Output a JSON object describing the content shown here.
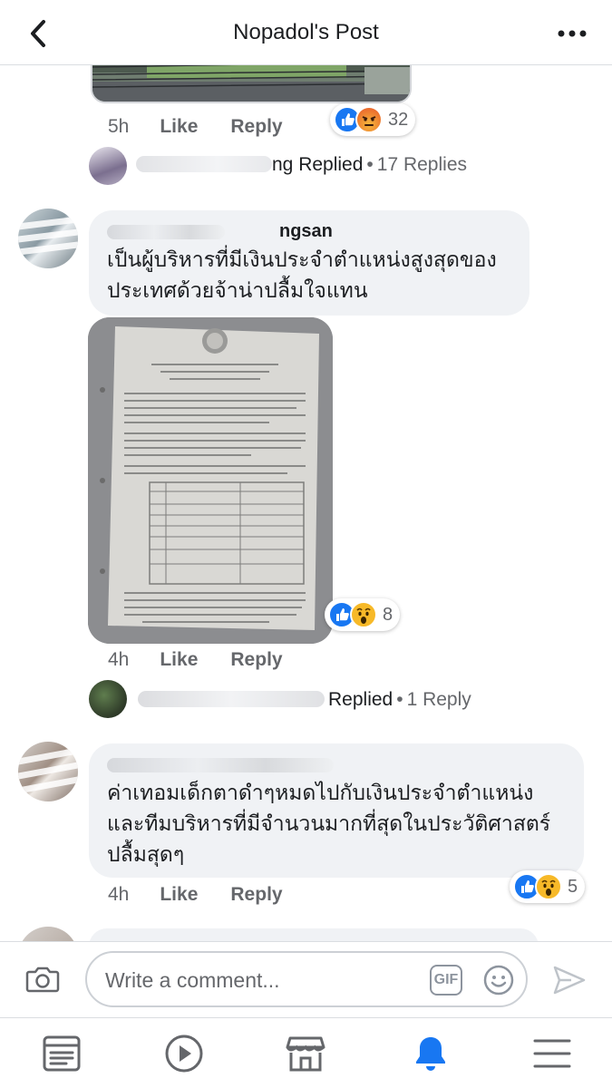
{
  "header": {
    "title": "Nopadol's Post",
    "back_icon": "chevron-left-icon",
    "more_icon": "more-horizontal-icon"
  },
  "colors": {
    "like_blue": "#1877f2",
    "angry_orange": "#f0772a",
    "wow_yellow": "#f7b928",
    "meta_gray": "#65676b",
    "bubble_bg": "#f0f2f5",
    "active_tab": "#1877f2"
  },
  "comments": [
    {
      "time": "5h",
      "like_label": "Like",
      "reply_label": "Reply",
      "reaction_count": "32",
      "reaction_icons": [
        "like-icon",
        "angry-icon"
      ],
      "reply_summary": {
        "name_visible": "ng Replied",
        "separator": "•",
        "count_label": "17 Replies"
      }
    },
    {
      "author_visible": "ngsan",
      "text": "เป็นผู้บริหารที่มีเงินประจำตำแหน่งสูงสุดของประเทศด้วยจ้าน่าปลื้มใจแทน",
      "time": "4h",
      "like_label": "Like",
      "reply_label": "Reply",
      "reaction_count": "8",
      "reaction_icons": [
        "like-icon",
        "wow-icon"
      ],
      "reply_summary": {
        "name_visible": "Replied",
        "separator": "•",
        "count_label": "1 Reply"
      }
    },
    {
      "text": "ค่าเทอมเด็กตาดำๆหมดไปกับเงินประจำตำแหน่ง และทีมบริหารที่มีจำนวนมากที่สุดในประวัติศาสตร์ ปลื้มสุดๆ",
      "time": "4h",
      "like_label": "Like",
      "reply_label": "Reply",
      "reaction_count": "5",
      "reaction_icons": [
        "like-icon",
        "wow-icon"
      ]
    }
  ],
  "composer": {
    "placeholder": "Write a comment...",
    "gif_label": "GIF",
    "camera_icon": "camera-icon",
    "emoji_icon": "emoji-icon",
    "send_icon": "send-icon"
  },
  "tabbar": {
    "items": [
      "news-feed-icon",
      "watch-icon",
      "marketplace-icon",
      "notifications-icon",
      "menu-icon"
    ],
    "active": "notifications-icon"
  }
}
